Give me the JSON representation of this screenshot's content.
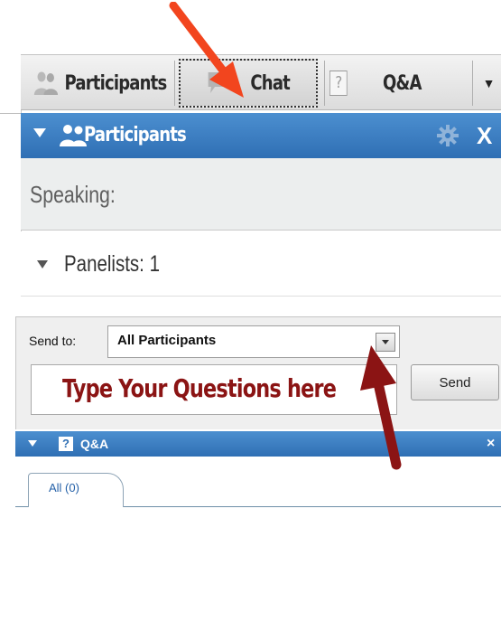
{
  "tabs": {
    "participants_label": "Participants",
    "chat_label": "Chat",
    "qa_label": "Q&A",
    "dropdown_glyph": "▼"
  },
  "participants_panel": {
    "title": "Participants",
    "close_glyph": "X",
    "speaking_label": "Speaking:",
    "panelists_label": "Panelists: 1"
  },
  "chat": {
    "send_to_label": "Send to:",
    "send_to_value": "All Participants",
    "input_text": "Type Your Questions here",
    "send_label": "Send"
  },
  "qa_panel": {
    "icon_glyph": "?",
    "title": "Q&A",
    "close_glyph": "×",
    "tab_all_label": "All (0)"
  },
  "icons": {
    "participants": "people-icon",
    "chat": "speech-bubble-icon",
    "qa": "question-icon",
    "settings": "gear-icon"
  },
  "colors": {
    "header_blue": "#3a7cc1",
    "annotation_red": "#f2451e",
    "annotation_dark_red": "#8b1414",
    "input_text_color": "#8b1414"
  }
}
